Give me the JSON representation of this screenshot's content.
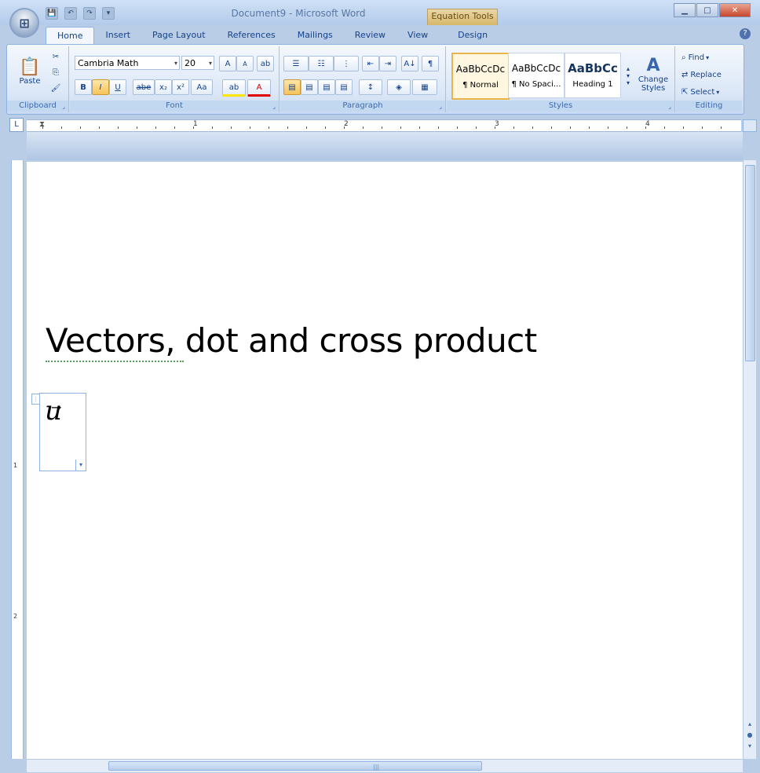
{
  "window": {
    "title": "Document9 - Microsoft Word",
    "context_tab": "Equation Tools",
    "controls": {
      "minimize": "▁",
      "maximize": "□",
      "close": "✕"
    }
  },
  "quick_access": {
    "save": "💾",
    "undo": "↶",
    "redo": "↷",
    "more": "▾"
  },
  "tabs": [
    "Home",
    "Insert",
    "Page Layout",
    "References",
    "Mailings",
    "Review",
    "View",
    "Design"
  ],
  "ribbon": {
    "clipboard": {
      "label": "Clipboard",
      "paste": "Paste",
      "cut": "✂",
      "copy": "⎘",
      "format_painter": "🖌"
    },
    "font": {
      "label": "Font",
      "font_name": "Cambria Math",
      "font_size": "20",
      "grow": "A",
      "shrink": "A",
      "clear": "ab",
      "bold": "B",
      "italic": "I",
      "underline": "U",
      "strike": "abe",
      "subscript": "x₂",
      "superscript": "x²",
      "change_case": "Aa",
      "highlight": "ab",
      "font_color": "A"
    },
    "paragraph": {
      "label": "Paragraph",
      "sort": "A↓",
      "show_marks": "¶"
    },
    "styles": {
      "label": "Styles",
      "items": [
        {
          "sample": "AaBbCcDc",
          "name": "¶ Normal"
        },
        {
          "sample": "AaBbCcDc",
          "name": "¶ No Spaci..."
        },
        {
          "sample": "AaBbCc",
          "name": "Heading 1"
        }
      ],
      "change_styles": "Change Styles"
    },
    "editing": {
      "label": "Editing",
      "find": "Find",
      "replace": "Replace",
      "select": "Select"
    }
  },
  "ruler": {
    "numbers": [
      "1",
      "2",
      "3",
      "4"
    ],
    "vnumbers": [
      "1",
      "2"
    ]
  },
  "document": {
    "heading": "Vectors, dot and cross product",
    "equation": "u",
    "equation_arrow": "→"
  },
  "accent": {
    "ribbon_border": "#8db2e3",
    "selected_style": "#e9b54b",
    "context_tab": "#d7b86a"
  }
}
